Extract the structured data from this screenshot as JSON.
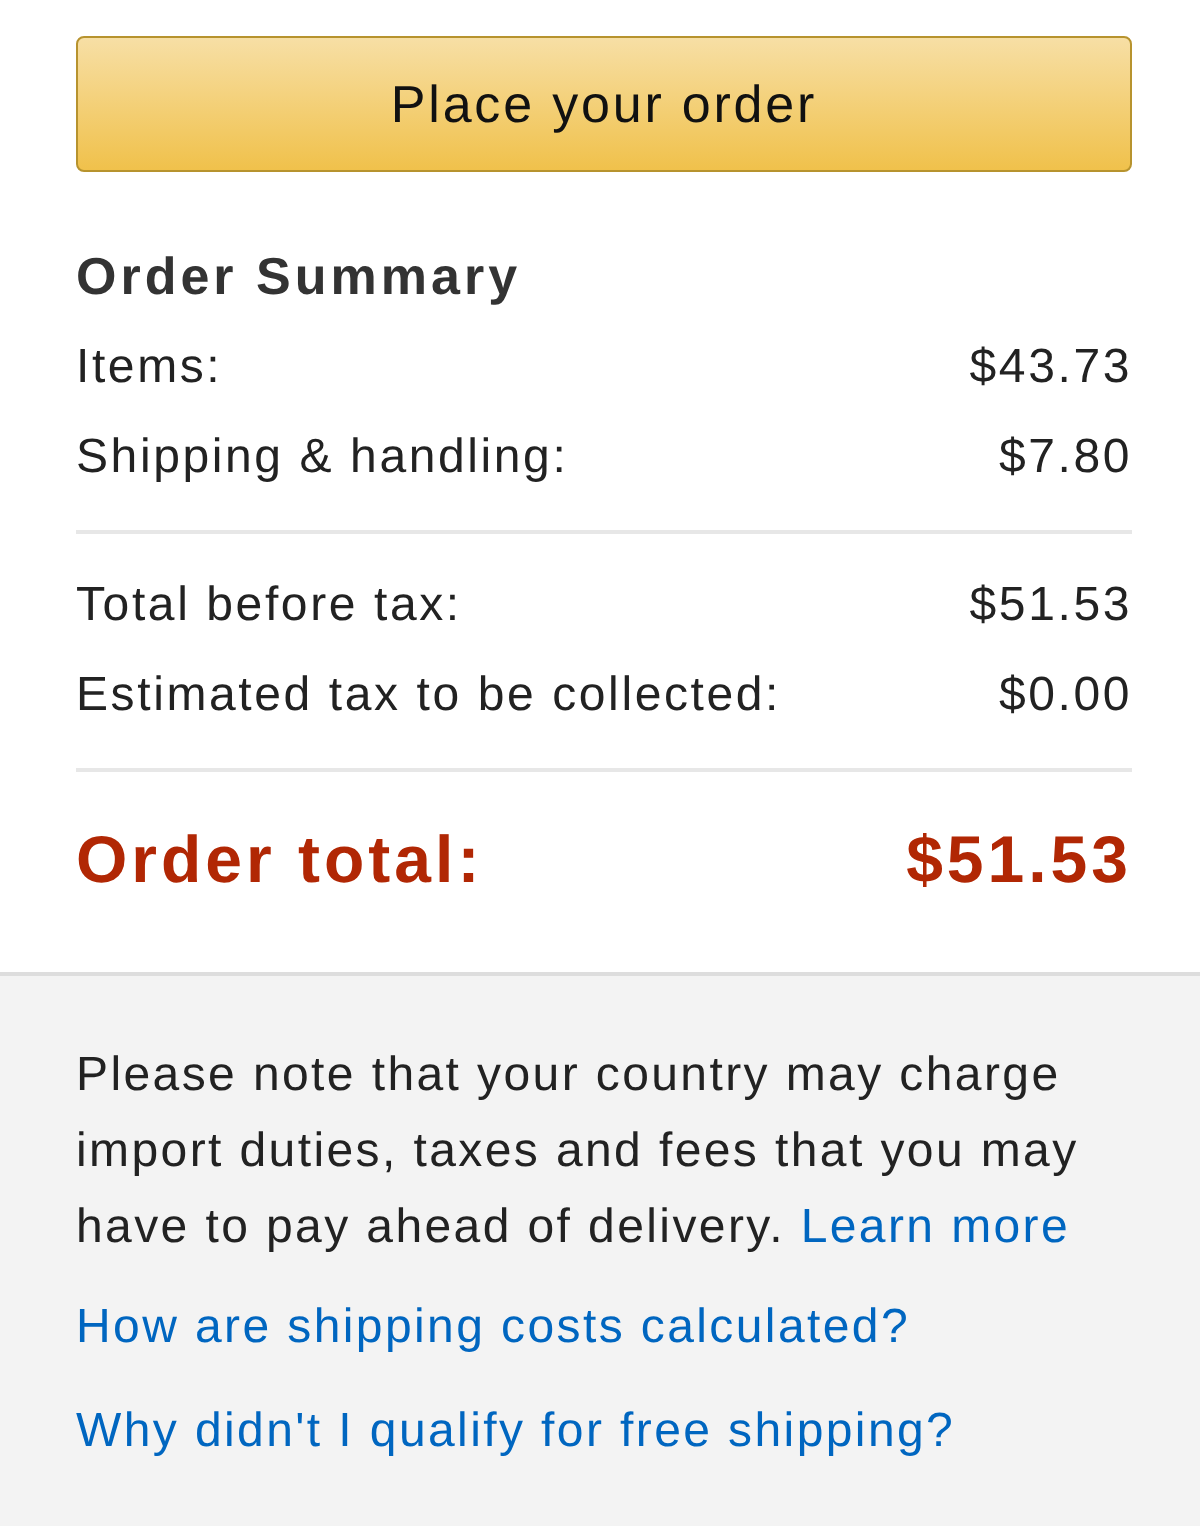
{
  "place_order_button": {
    "label": "Place your order"
  },
  "order_summary": {
    "title": "Order Summary",
    "groups": [
      [
        {
          "label": "Items:",
          "amount": "$43.73"
        },
        {
          "label": "Shipping & handling:",
          "amount": "$7.80"
        }
      ],
      [
        {
          "label": "Total before tax:",
          "amount": "$51.53"
        },
        {
          "label": "Estimated tax to be collected:",
          "amount": "$0.00"
        }
      ]
    ],
    "total": {
      "label": "Order total:",
      "amount": "$51.53"
    }
  },
  "notice": {
    "text": "Please note that your country may charge import duties, taxes and fees that you may have to pay ahead of delivery.",
    "link": "Learn more"
  },
  "help_links": [
    "How are shipping costs calculated?",
    "Why didn't I qualify for free shipping?"
  ]
}
